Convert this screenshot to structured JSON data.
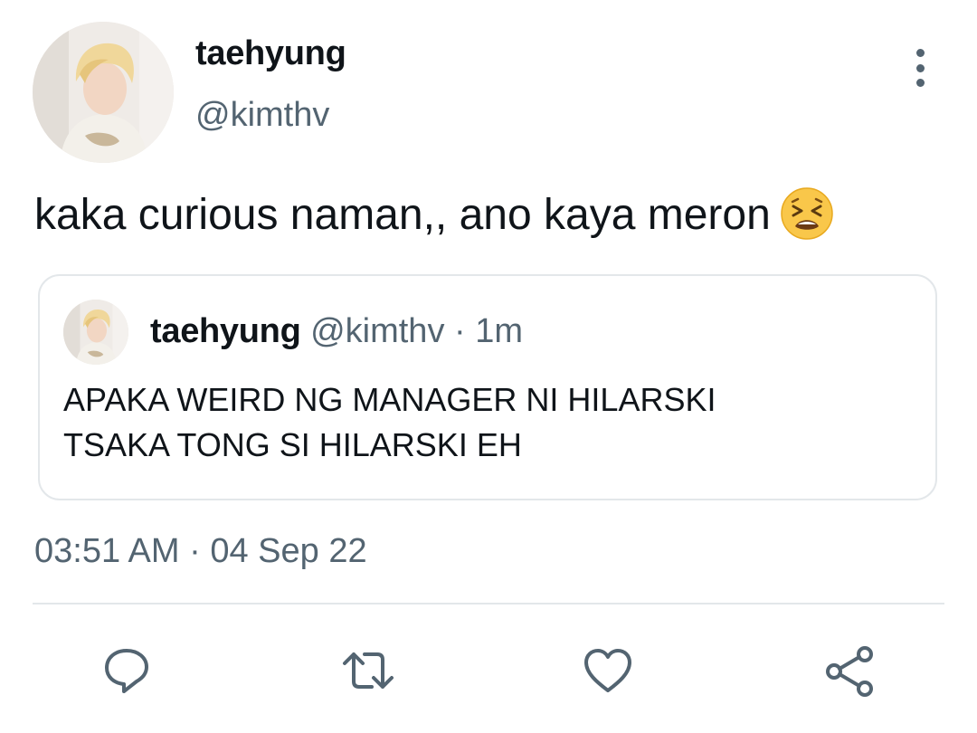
{
  "tweet": {
    "author": {
      "display_name": "taehyung",
      "handle": "@kimthv"
    },
    "text": "kaka curious naman,, ano kaya meron",
    "emoji_icon": "tired-face-emoji",
    "timestamp": "03:51 AM · 04 Sep 22"
  },
  "quoted_tweet": {
    "display_name": "taehyung",
    "handle": "@kimthv",
    "age": "1m",
    "separator": " · ",
    "text_line_1": "APAKA WEIRD NG MANAGER NI HILARSKI",
    "text_line_2": "TSAKA TONG SI HILARSKI EH"
  },
  "actions": [
    {
      "name": "reply",
      "icon": "reply-icon"
    },
    {
      "name": "retweet",
      "icon": "retweet-icon"
    },
    {
      "name": "like",
      "icon": "heart-icon"
    },
    {
      "name": "share",
      "icon": "share-icon"
    }
  ],
  "colors": {
    "text_primary": "#0f1419",
    "text_secondary": "#536471",
    "border": "#e3e7ea",
    "icon": "#536471"
  }
}
